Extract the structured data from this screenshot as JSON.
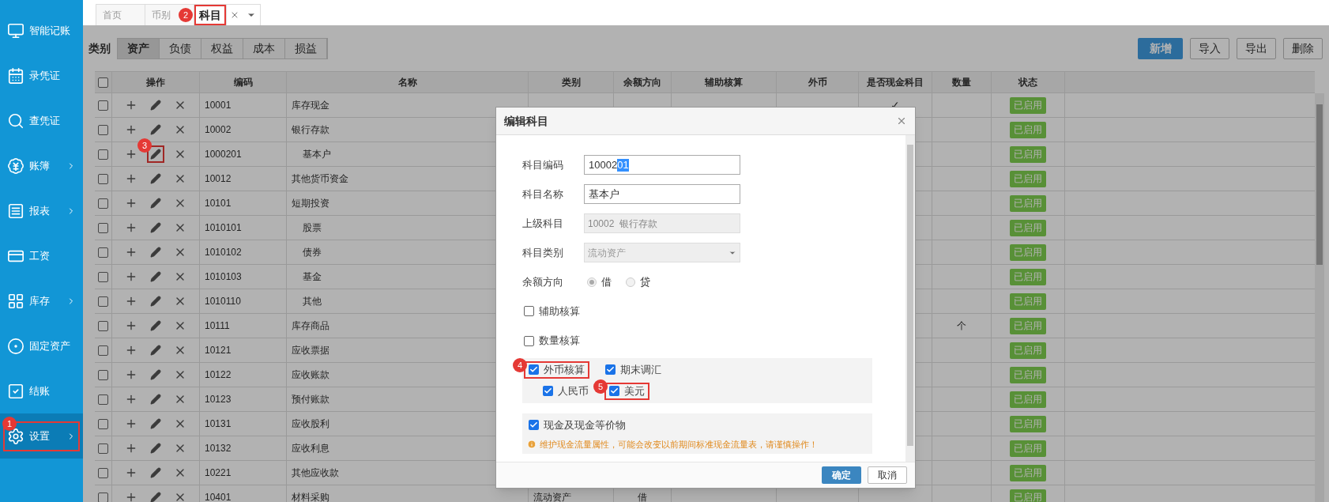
{
  "sidebar": {
    "items": [
      {
        "label": "智能记账",
        "submenu": false,
        "selected": false
      },
      {
        "label": "录凭证",
        "submenu": false,
        "selected": false
      },
      {
        "label": "查凭证",
        "submenu": false,
        "selected": false
      },
      {
        "label": "账簿",
        "submenu": true,
        "selected": false
      },
      {
        "label": "报表",
        "submenu": true,
        "selected": false
      },
      {
        "label": "工资",
        "submenu": false,
        "selected": false
      },
      {
        "label": "库存",
        "submenu": true,
        "selected": false
      },
      {
        "label": "固定资产",
        "submenu": false,
        "selected": false
      },
      {
        "label": "结账",
        "submenu": false,
        "selected": false
      },
      {
        "label": "设置",
        "submenu": true,
        "selected": true,
        "callout": "1"
      }
    ]
  },
  "tabs": [
    {
      "label": "首页",
      "selected": false,
      "closable": false
    },
    {
      "label": "币别",
      "selected": false,
      "closable": false
    },
    {
      "label": "科目",
      "selected": true,
      "closable": true,
      "callout": "2"
    }
  ],
  "toolbar": {
    "category_label": "类别",
    "category_tabs": [
      {
        "label": "资产",
        "selected": true
      },
      {
        "label": "负债",
        "selected": false
      },
      {
        "label": "权益",
        "selected": false
      },
      {
        "label": "成本",
        "selected": false
      },
      {
        "label": "损益",
        "selected": false
      }
    ],
    "buttons": [
      {
        "label": "新增",
        "primary": true
      },
      {
        "label": "导入",
        "primary": false
      },
      {
        "label": "导出",
        "primary": false
      },
      {
        "label": "删除",
        "primary": false
      }
    ]
  },
  "table": {
    "select_all_checked": false,
    "columns": [
      "操作",
      "编码",
      "名称",
      "类别",
      "余额方向",
      "辅助核算",
      "外币",
      "是否现金科目",
      "数量",
      "状态"
    ],
    "rows": [
      {
        "checked": false,
        "code": "10001",
        "name": "库存现金",
        "cash": "✓",
        "status": "已启用"
      },
      {
        "checked": false,
        "code": "10002",
        "name": "银行存款",
        "status": "已启用",
        "children": [
          {
            "checked": false,
            "code": "1000201",
            "name": "基本户",
            "status": "已启用",
            "edit_callout": "3"
          }
        ]
      },
      {
        "checked": false,
        "code": "10012",
        "name": "其他货币资金",
        "status": "已启用"
      },
      {
        "checked": false,
        "code": "10101",
        "name": "短期投资",
        "status": "已启用",
        "children": [
          {
            "checked": false,
            "code": "1010101",
            "name": "股票",
            "status": "已启用"
          },
          {
            "checked": false,
            "code": "1010102",
            "name": "债券",
            "status": "已启用"
          },
          {
            "checked": false,
            "code": "1010103",
            "name": "基金",
            "status": "已启用"
          },
          {
            "checked": false,
            "code": "1010110",
            "name": "其他",
            "status": "已启用"
          }
        ]
      },
      {
        "checked": false,
        "code": "10111",
        "name": "库存商品",
        "quantity": "个",
        "status": "已启用"
      },
      {
        "checked": false,
        "code": "10121",
        "name": "应收票据",
        "status": "已启用"
      },
      {
        "checked": false,
        "code": "10122",
        "name": "应收账款",
        "status": "已启用"
      },
      {
        "checked": false,
        "code": "10123",
        "name": "预付账款",
        "status": "已启用"
      },
      {
        "checked": false,
        "code": "10131",
        "name": "应收股利",
        "status": "已启用"
      },
      {
        "checked": false,
        "code": "10132",
        "name": "应收利息",
        "status": "已启用"
      },
      {
        "checked": false,
        "code": "10221",
        "name": "其他应收款",
        "status": "已启用"
      },
      {
        "checked": false,
        "code": "10401",
        "name": "材料采购",
        "category": "流动资产",
        "direction": "借",
        "status": "已启用"
      }
    ]
  },
  "dialog": {
    "title": "编辑科目",
    "fields": [
      {
        "kind": "input",
        "label": "科目编码",
        "value": "10002",
        "selected_part": "01"
      },
      {
        "kind": "input",
        "label": "科目名称",
        "value": "基本户"
      },
      {
        "kind": "readonly",
        "label": "上级科目",
        "value": "10002  银行存款"
      },
      {
        "kind": "select",
        "label": "科目类别",
        "value": "流动资产"
      },
      {
        "kind": "radio",
        "label": "余额方向",
        "options": [
          {
            "label": "借",
            "selected": true
          },
          {
            "label": "贷",
            "selected": false
          }
        ]
      },
      {
        "kind": "checkbox",
        "label": "辅助核算",
        "checked": false
      },
      {
        "kind": "checkbox",
        "label": "数量核算",
        "checked": false
      },
      {
        "kind": "panel",
        "rows": [
          {
            "items": [
              {
                "label": "外币核算",
                "checked": true,
                "callout": "4"
              },
              {
                "label": "期末调汇",
                "checked": true
              }
            ]
          },
          {
            "items": [
              {
                "label": "人民币",
                "checked": true
              },
              {
                "label": "美元",
                "checked": true,
                "callout": "5"
              }
            ]
          }
        ]
      },
      {
        "kind": "panel",
        "rows": [
          {
            "items": [
              {
                "label": "现金及现金等价物",
                "checked": true
              }
            ]
          }
        ],
        "warning": "维护现金流量属性，可能会改变以前期间标准现金流量表，请谨慎操作！"
      }
    ],
    "footer": [
      {
        "label": "确定",
        "primary": true
      },
      {
        "label": "取消",
        "primary": false
      }
    ]
  }
}
